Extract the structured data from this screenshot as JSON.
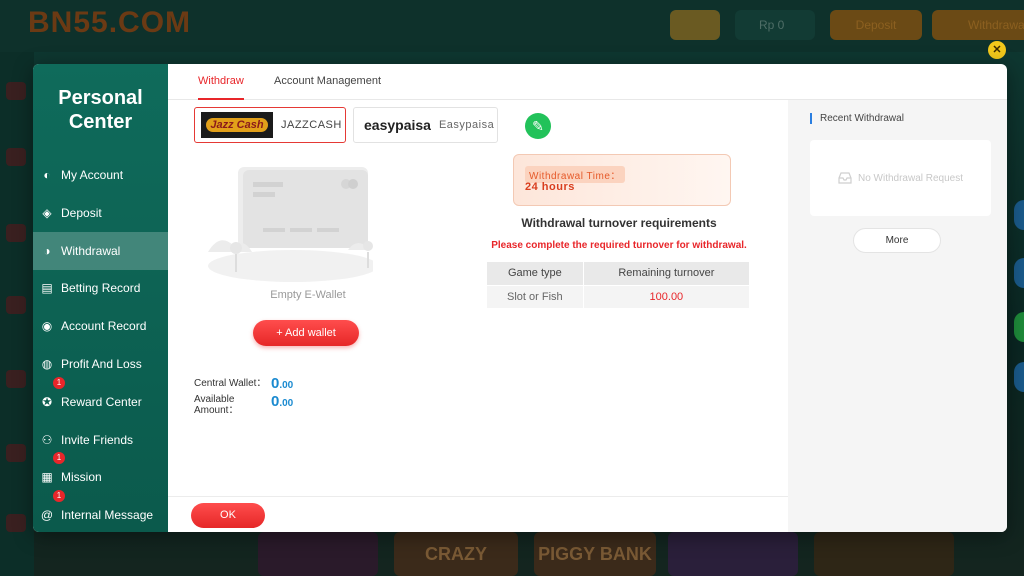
{
  "site": {
    "logo": "BN55.COM",
    "balance_short": "Rp 0",
    "btn1": "Deposit",
    "btn2": "Withdrawal"
  },
  "background_games": [
    "CRAZY MONKEY",
    "PIGGY BANK"
  ],
  "sidebar": {
    "title": "Personal Center",
    "items": [
      {
        "label": "My Account",
        "icon": "account-icon",
        "active": false,
        "badge": ""
      },
      {
        "label": "Deposit",
        "icon": "deposit-icon",
        "active": false,
        "badge": ""
      },
      {
        "label": "Withdrawal",
        "icon": "withdrawal-icon",
        "active": true,
        "badge": ""
      },
      {
        "label": "Betting Record",
        "icon": "betting-record-icon",
        "active": false,
        "badge": ""
      },
      {
        "label": "Account Record",
        "icon": "account-record-icon",
        "active": false,
        "badge": ""
      },
      {
        "label": "Profit And Loss",
        "icon": "profit-loss-icon",
        "active": false,
        "badge": ""
      },
      {
        "label": "Reward Center",
        "icon": "reward-icon",
        "active": false,
        "badge": "1"
      },
      {
        "label": "Invite Friends",
        "icon": "invite-icon",
        "active": false,
        "badge": ""
      },
      {
        "label": "Mission",
        "icon": "gift-icon",
        "active": false,
        "badge": "1"
      },
      {
        "label": "Internal Message",
        "icon": "at-icon",
        "active": false,
        "badge": "1"
      }
    ]
  },
  "tabs": {
    "withdraw": "Withdraw",
    "account_management": "Account Management"
  },
  "wallets": [
    {
      "logo_text": "Jazz Cash",
      "name": "JAZZCASH"
    },
    {
      "logo_text": "easypaisa",
      "name": "Easypaisa"
    }
  ],
  "empty_wallet": "Empty E-Wallet",
  "add_wallet": "+ Add wallet",
  "balances": {
    "central_label": "Central Wallet：",
    "central_value": "0",
    "central_decimals": ".00",
    "available_label_1": "Available",
    "available_label_2": "Amount：",
    "available_value": "0",
    "available_decimals": ".00"
  },
  "withdrawal_time": {
    "label": "Withdrawal Time：",
    "value": "24 hours"
  },
  "turnover": {
    "title": "Withdrawal turnover requirements",
    "warning": "Please complete the required turnover for withdrawal.",
    "headers": [
      "Game type",
      "Remaining turnover"
    ],
    "rows": [
      [
        "Slot or Fish",
        "100.00"
      ]
    ]
  },
  "ok": "OK",
  "recent": {
    "title": "Recent Withdrawal",
    "empty": "No Withdrawal Request",
    "more": "More"
  },
  "colors": {
    "accent": "#e8262a",
    "sidebar": "#0f6b5b",
    "value_blue": "#1a8ad0",
    "edit_green": "#22c25a"
  }
}
